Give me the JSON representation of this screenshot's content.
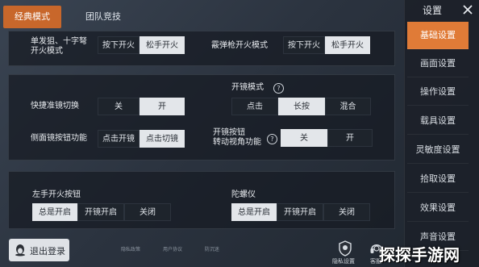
{
  "tabs": [
    "经典模式",
    "团队竞技"
  ],
  "panel1": {
    "left_label": "单发狙、十字弩\n开火模式",
    "left_options": [
      "按下开火",
      "松手开火"
    ],
    "right_label": "霰弹枪开火模式",
    "right_options": [
      "按下开火",
      "松手开火"
    ]
  },
  "panel2": {
    "fire_mode_label": "开镜模式",
    "fire_mode_options": [
      "点击",
      "长按",
      "混合"
    ],
    "quick_scope_label": "快捷准镜切换",
    "quick_scope_options": [
      "关",
      "开"
    ],
    "side_scope_label": "侧面镜按钮功能",
    "side_scope_options": [
      "点击开镜",
      "点击切镜"
    ],
    "scope_view_label": "开镜按钮\n转动视角功能",
    "scope_view_options": [
      "关",
      "开"
    ]
  },
  "panel3": {
    "left_fire_label": "左手开火按钮",
    "left_fire_options": [
      "总是开启",
      "开镜开启",
      "关闭"
    ],
    "gyro_label": "陀螺仪",
    "gyro_options": [
      "总是开启",
      "开镜开启",
      "关闭"
    ]
  },
  "footer": {
    "logout_label": "退出登录",
    "small_links": [
      "隐私政策",
      "用户协议",
      "防沉迷"
    ],
    "privacy_label": "隐私设置",
    "service_label": "客服"
  },
  "sidebar": {
    "title": "设置",
    "items": [
      "基础设置",
      "画面设置",
      "操作设置",
      "载具设置",
      "灵敏度设置",
      "拾取设置",
      "效果设置",
      "声音设置"
    ]
  },
  "watermark": "探探手游网"
}
